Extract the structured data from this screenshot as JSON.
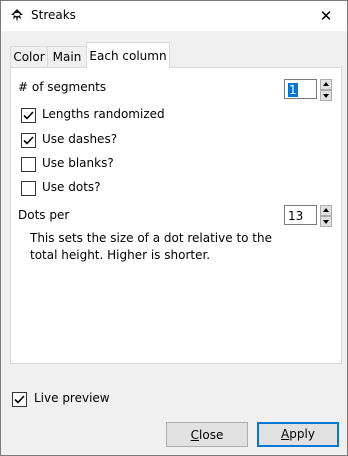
{
  "window": {
    "title": "Streaks",
    "close_glyph": "✕"
  },
  "tabs": [
    {
      "label": "Color",
      "active": false
    },
    {
      "label": "Main",
      "active": false
    },
    {
      "label": "Each column",
      "active": true
    }
  ],
  "panel": {
    "segments_label": "# of segments",
    "segments_value": "1",
    "lengths_randomized": {
      "label": "Lengths randomized",
      "checked": true
    },
    "use_dashes": {
      "label": "Use dashes?",
      "checked": true
    },
    "use_blanks": {
      "label": "Use blanks?",
      "checked": false
    },
    "use_dots": {
      "label": "Use dots?",
      "checked": false
    },
    "dots_per_label": "Dots per",
    "dots_per_value": "13",
    "description": "This sets the size of a dot relative to the total height. Higher is shorter."
  },
  "footer": {
    "live_preview": {
      "label": "Live preview",
      "checked": true
    },
    "close_first": "C",
    "close_rest": "lose",
    "apply_first": "A",
    "apply_rest": "pply"
  },
  "colors": {
    "accent": "#0078d7",
    "selection": "#0078d7"
  }
}
